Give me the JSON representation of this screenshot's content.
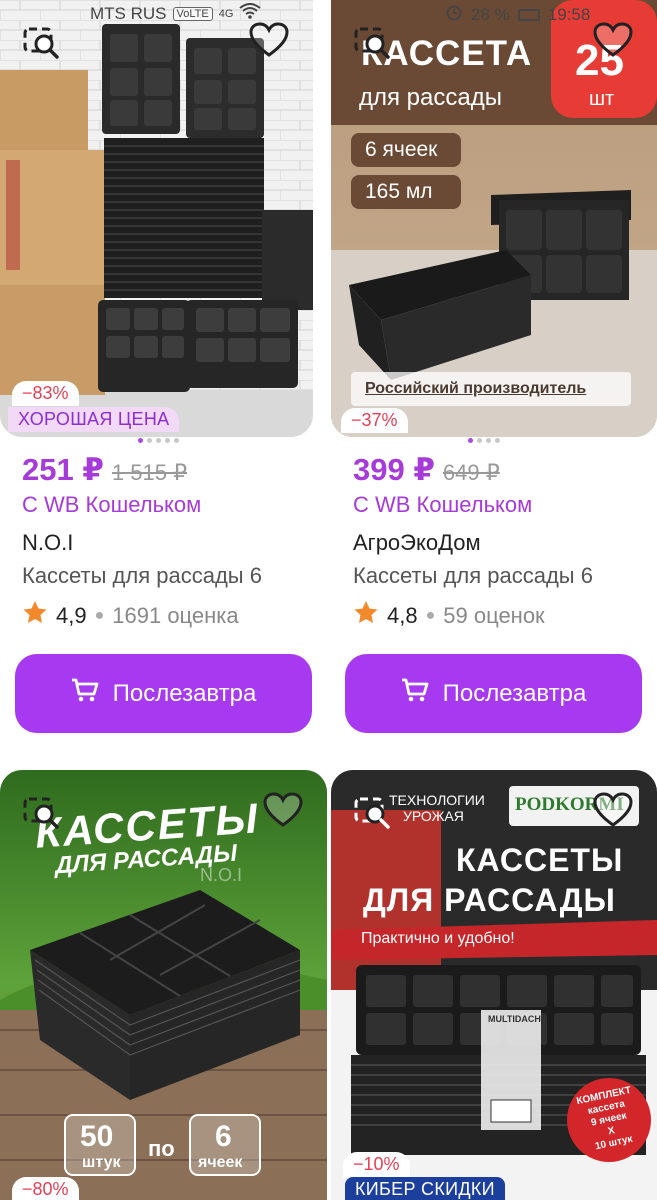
{
  "status_bar": {
    "carrier": "MTS RUS",
    "volte": "VoLTE",
    "network": "4G",
    "battery": "28 %",
    "time": "19:58"
  },
  "products": [
    {
      "discount": "−83%",
      "promo": "ХОРОШАЯ ЦЕНА",
      "price": "251 ₽",
      "old_price": "1 515 ₽",
      "wallet": "С WB Кошельком",
      "brand": "N.O.I",
      "title": "Кассеты для рассады 6",
      "rating": "4,9",
      "reviews": "1691 оценка",
      "button": "Послезавтра"
    },
    {
      "banner_title": "КАССЕТА",
      "banner_subtitle": "для рассады",
      "banner_count": "25",
      "banner_unit": "шт",
      "chip_1": "6 ячеек",
      "chip_2": "165 мл",
      "caption": "Российский производитель",
      "discount": "−37%",
      "price": "399 ₽",
      "old_price": "649 ₽",
      "wallet": "С WB Кошельком",
      "brand": "АгроЭкоДом",
      "title": "Кассеты для рассады 6",
      "rating": "4,8",
      "reviews": "59 оценок",
      "button": "Послезавтра"
    },
    {
      "banner_title": "КАССЕТЫ",
      "banner_subtitle": "ДЛЯ РАССАДЫ",
      "watermark": "N.O.I",
      "count_num": "50",
      "count_word": "штук",
      "by": "по",
      "cells_num": "6",
      "cells_word": "ячеек",
      "discount": "−80%"
    },
    {
      "tech_1": "ТЕХНОЛОГИИ",
      "tech_2": "УРОЖАЯ",
      "logo": "PODKORMI",
      "banner_title_1": "КАССЕТЫ",
      "banner_title_2": "ДЛЯ РАССАДЫ",
      "ribbon": "Практично и удобно!",
      "package_label": "MULTIDACHA",
      "kit_1": "КОМПЛЕКТ",
      "kit_2": "кассета",
      "kit_3": "9 ячеек",
      "kit_4": "X",
      "kit_5": "10 штук",
      "discount": "−10%",
      "promo": "КИБЕР СКИДКИ"
    }
  ],
  "colors": {
    "accent": "#a73af0",
    "price": "#a63bd9",
    "discount": "#e63f55",
    "star": "#f2892b"
  }
}
